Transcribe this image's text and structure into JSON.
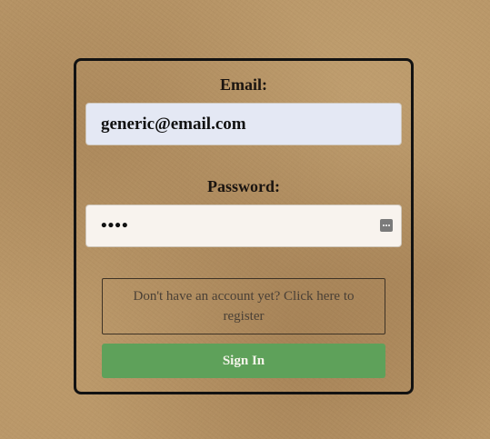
{
  "form": {
    "email_label": "Email:",
    "email_value": "generic@email.com",
    "password_label": "Password:",
    "password_value": "1234",
    "register_text": "Don't have an account yet? Click here to register",
    "signin_label": "Sign In"
  },
  "colors": {
    "background": "#b89668",
    "card_border": "#121212",
    "email_field_bg": "#e4e8f4",
    "password_field_bg": "#f8f3ee",
    "signin_button": "#5ea15a"
  },
  "icons": {
    "password_reveal": "password-reveal-icon"
  }
}
